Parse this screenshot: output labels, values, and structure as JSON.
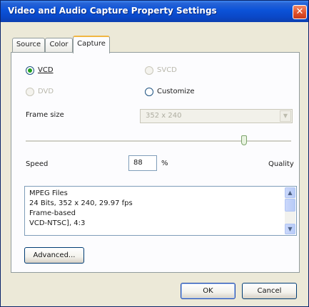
{
  "window": {
    "title": "Video and Audio Capture Property Settings",
    "close_glyph": "✕"
  },
  "tabs": [
    {
      "label": "Source"
    },
    {
      "label": "Color"
    },
    {
      "label": "Capture"
    }
  ],
  "active_tab": "Capture",
  "capture": {
    "formats": {
      "vcd": {
        "label": "VCD",
        "selected": true,
        "enabled": true
      },
      "svcd": {
        "label": "SVCD",
        "selected": false,
        "enabled": false
      },
      "dvd": {
        "label": "DVD",
        "selected": false,
        "enabled": false
      },
      "customize": {
        "label": "Customize",
        "selected": false,
        "enabled": true
      }
    },
    "frame_size_label": "Frame size",
    "frame_size_value": "352 x 240",
    "quality_slider_level": 0.88,
    "speed_label": "Speed",
    "quality_value": "88",
    "percent_label": "%",
    "quality_label": "Quality",
    "info_lines": [
      "MPEG Files",
      "24 Bits, 352 x 240, 29.97 fps",
      "Frame-based",
      "VCD-NTSC], 4:3"
    ],
    "advanced_label": "Advanced..."
  },
  "footer": {
    "ok_label": "OK",
    "cancel_label": "Cancel"
  },
  "colors": {
    "titlebar": "#0b52d8",
    "close_button": "#e2522a",
    "active_tab_accent": "#f1b642",
    "radio_dot": "#21a121"
  }
}
